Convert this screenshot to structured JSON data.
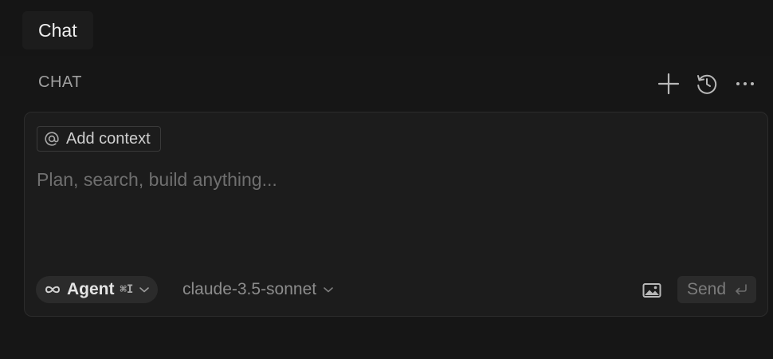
{
  "tab_bar": {
    "active_tab": "Chat"
  },
  "section": {
    "title": "CHAT",
    "actions": [
      {
        "icon": "plus-icon"
      },
      {
        "icon": "history-icon"
      },
      {
        "icon": "more-icon"
      }
    ]
  },
  "composer": {
    "context_chip": {
      "icon": "at-icon",
      "label": "Add context"
    },
    "input": {
      "value": "",
      "placeholder": "Plan, search, build anything..."
    },
    "mode": {
      "icon": "infinity-icon",
      "label": "Agent",
      "shortcut": "⌘I"
    },
    "model": {
      "selected": "claude-3.5-sonnet"
    },
    "image_button": {
      "icon": "image-icon"
    },
    "send": {
      "label": "Send",
      "icon": "enter-icon"
    }
  },
  "colors": {
    "background": "#161616",
    "panel": "#1c1c1c",
    "pill": "#2b2b2b",
    "text_primary": "#e4e4e4",
    "text_muted": "#8c8c8c"
  }
}
